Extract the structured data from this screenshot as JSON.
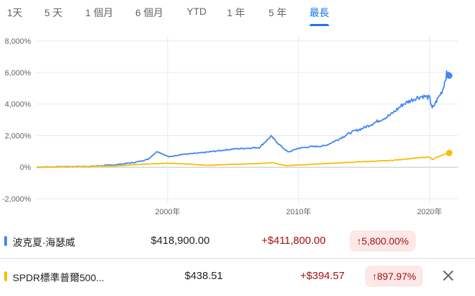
{
  "ranges": {
    "tabs": [
      "1天",
      "5 天",
      "1 個月",
      "6 個月",
      "YTD",
      "1 年",
      "5 年",
      "最長"
    ],
    "active_index": 7
  },
  "chart_data": {
    "type": "line",
    "y_tick_labels": [
      "8,000%",
      "6,000%",
      "4,000%",
      "2,000%",
      "0%",
      "-2,000%"
    ],
    "y_ticks": [
      8000,
      6000,
      4000,
      2000,
      0,
      -2000
    ],
    "ylim": [
      -2000,
      8000
    ],
    "x_tick_labels": [
      "2000年",
      "2010年",
      "2020年"
    ],
    "x_ticks": [
      2000,
      2010,
      2020
    ],
    "xlim": [
      1990,
      2021.8
    ],
    "grid": true,
    "series": [
      {
        "name": "波克夏·海瑟威",
        "color": "#4285f4",
        "x": [
          1990,
          1992,
          1994,
          1996,
          1997.5,
          1998.5,
          1999.2,
          2000.1,
          2001,
          2002.5,
          2003.5,
          2005,
          2007,
          2007.9,
          2008.7,
          2009.2,
          2010,
          2011,
          2012,
          2013,
          2014,
          2015,
          2016,
          2017,
          2018,
          2019,
          2019.5,
          2020,
          2020.2,
          2020.6,
          2021,
          2021.3,
          2021.5
        ],
        "y": [
          0,
          30,
          50,
          150,
          300,
          500,
          1000,
          650,
          800,
          900,
          1000,
          1150,
          1250,
          1950,
          1300,
          950,
          1200,
          1300,
          1350,
          1750,
          2200,
          2500,
          2900,
          3300,
          4000,
          4400,
          4500,
          4400,
          3700,
          4300,
          4900,
          5900,
          5800
        ]
      },
      {
        "name": "SPDR標準普爾500...",
        "color": "#fbbc04",
        "x": [
          1990,
          1993,
          1996,
          1998,
          2000,
          2001.5,
          2003,
          2005,
          2007,
          2008,
          2009,
          2011,
          2013,
          2015,
          2017,
          2019,
          2020,
          2020.2,
          2021,
          2021.5
        ],
        "y": [
          0,
          30,
          80,
          180,
          250,
          200,
          120,
          180,
          230,
          280,
          100,
          180,
          270,
          350,
          420,
          580,
          650,
          480,
          780,
          900
        ]
      }
    ]
  },
  "stocks": [
    {
      "name": "波克夏·海瑟威",
      "color": "#4285f4",
      "price": "$418,900.00",
      "change": "+$411,800.00",
      "percent": "5,800.00%"
    },
    {
      "name": "SPDR標準普爾500...",
      "color": "#fbbc04",
      "price": "$438.51",
      "change": "+$394.57",
      "percent": "897.97%"
    }
  ],
  "icons": {
    "up_arrow": "arrow-up-icon",
    "close": "close-icon"
  }
}
